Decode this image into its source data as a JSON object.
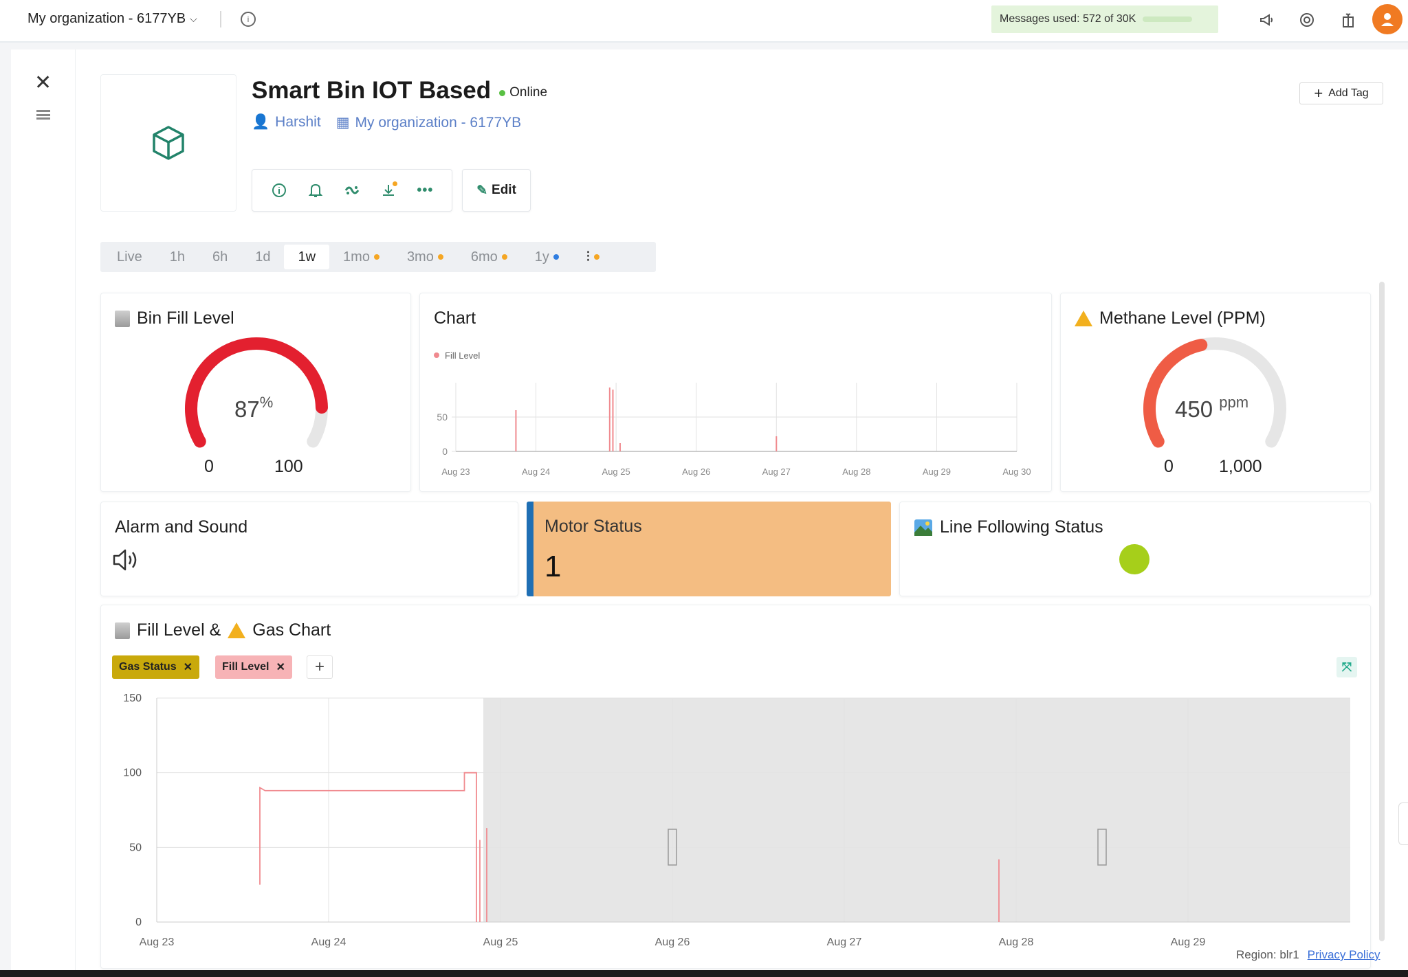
{
  "topbar": {
    "org_label": "My organization - 6177YB",
    "messages": "Messages used: 572 of 30K"
  },
  "device": {
    "title": "Smart Bin IOT Based",
    "status": "Online",
    "owner": "Harshit",
    "organization": "My organization - 6177YB",
    "add_tag": "Add Tag",
    "edit": "Edit"
  },
  "time_tabs": [
    {
      "label": "Live",
      "dot": null
    },
    {
      "label": "1h",
      "dot": null
    },
    {
      "label": "6h",
      "dot": null
    },
    {
      "label": "1d",
      "dot": null
    },
    {
      "label": "1w",
      "dot": null,
      "active": true
    },
    {
      "label": "1mo",
      "dot": "#f5a623"
    },
    {
      "label": "3mo",
      "dot": "#f5a623"
    },
    {
      "label": "6mo",
      "dot": "#f5a623"
    },
    {
      "label": "1y",
      "dot": "#2f7de1"
    },
    {
      "label": "",
      "dot": "#f5a623",
      "icon": "sliders-icon"
    }
  ],
  "widgets": {
    "bin_fill": {
      "title": "Bin Fill Level",
      "value": 87,
      "unit": "%",
      "min": "0",
      "max": "100",
      "color": "#e3202f"
    },
    "chart_title": "Chart",
    "methane": {
      "title": "Methane Level (PPM)",
      "value": 450,
      "unit": "ppm",
      "min": "0",
      "max": "1,000",
      "color": "#ef5c45"
    },
    "alarm": {
      "title": "Alarm and Sound"
    },
    "motor": {
      "title": "Motor Status",
      "value": "1"
    },
    "line_following": {
      "title": "Line Following Status",
      "indicator_color": "#a6cf1a"
    },
    "combo_title_part1": "Fill Level &",
    "combo_title_part2": "Gas Chart",
    "tags": [
      {
        "label": "Gas Status",
        "color": "#c9a90b"
      },
      {
        "label": "Fill Level",
        "color": "#f7b3b6"
      }
    ]
  },
  "chart_data": [
    {
      "type": "line",
      "title": "Chart",
      "series": [
        {
          "name": "Fill Level",
          "color": "#f08a8f"
        }
      ],
      "x_ticks": [
        "Aug 23",
        "Aug 24",
        "Aug 25",
        "Aug 26",
        "Aug 27",
        "Aug 28",
        "Aug 29",
        "Aug 30"
      ],
      "y_ticks": [
        "0",
        "50"
      ],
      "ylim": [
        0,
        100
      ],
      "spikes": [
        {
          "x": 23.75,
          "y": 60
        },
        {
          "x": 24.92,
          "y": 93
        },
        {
          "x": 24.96,
          "y": 90
        },
        {
          "x": 25.05,
          "y": 12
        },
        {
          "x": 27.0,
          "y": 22
        }
      ],
      "grid": true,
      "legend": "top-left"
    },
    {
      "type": "line",
      "title": "Fill Level & Gas Chart",
      "series": [
        {
          "name": "Fill Level",
          "color": "#f08a8f"
        },
        {
          "name": "Gas Status",
          "color": "#c9a90b"
        }
      ],
      "x_ticks": [
        "Aug 23",
        "Aug 24",
        "Aug 25",
        "Aug 26",
        "Aug 27",
        "Aug 28",
        "Aug 29"
      ],
      "y_ticks": [
        "0",
        "50",
        "100",
        "150"
      ],
      "ylim": [
        0,
        150
      ],
      "fill_path": [
        [
          23.6,
          25
        ],
        [
          23.6,
          90
        ],
        [
          23.63,
          88
        ],
        [
          24.79,
          88
        ],
        [
          24.79,
          100
        ],
        [
          24.86,
          100
        ],
        [
          24.86,
          0
        ]
      ],
      "spikes": [
        {
          "x": 24.88,
          "y": 55
        },
        {
          "x": 24.92,
          "y": 63
        },
        {
          "x": 27.9,
          "y": 42
        }
      ],
      "shaded_from": 24.9,
      "grid": true
    }
  ],
  "footer": {
    "region": "Region: blr1",
    "privacy": "Privacy Policy"
  }
}
